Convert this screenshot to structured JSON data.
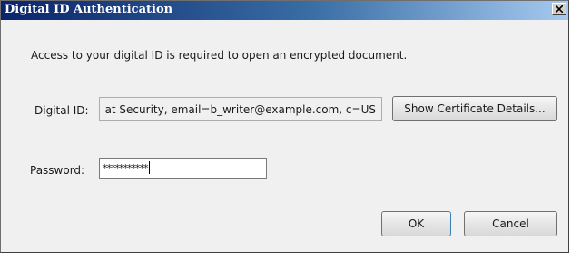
{
  "window": {
    "title": "Digital ID Authentication"
  },
  "dialog": {
    "message": "Access to your digital ID is required to open an encrypted document.",
    "digital_id_label": "Digital ID:",
    "digital_id_value": "at Security, email=b_writer@example.com, c=US",
    "show_cert_label": "Show Certificate Details...",
    "password_label": "Password:",
    "password_value": "***********",
    "ok_label": "OK",
    "cancel_label": "Cancel"
  },
  "icons": {
    "close": "close-icon"
  },
  "colors": {
    "title_bar_start": "#0a246a",
    "title_bar_end": "#a6caf0",
    "dialog_background": "#f0f0f0"
  }
}
